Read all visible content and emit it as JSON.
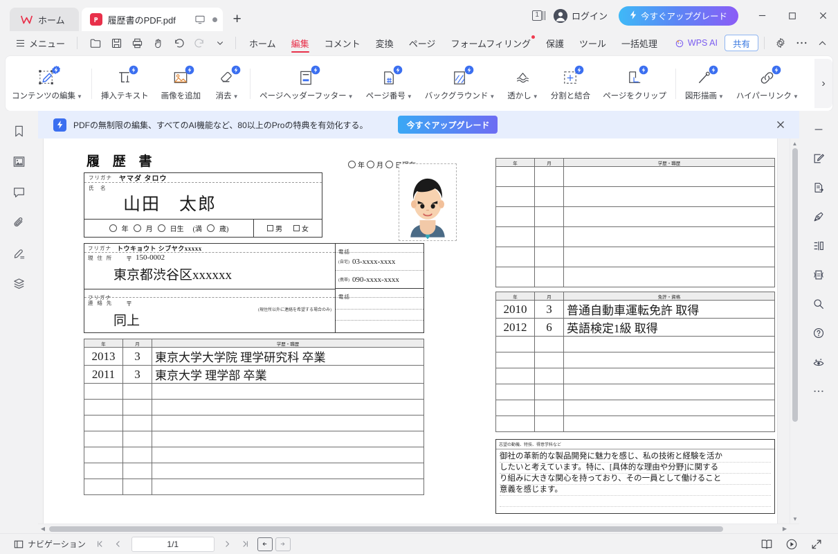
{
  "titlebar": {
    "home_tab": "ホーム",
    "doc_tab": "履歴書のPDF.pdf",
    "new_tab": "+",
    "page_count_badge": "1",
    "login_label": "ログイン",
    "upgrade_label": "今すぐアップグレード",
    "minimize": "–",
    "maximize": "□",
    "close": "✕"
  },
  "menubar": {
    "menu_label": "メニュー",
    "quick_actions": [
      "open-icon",
      "save-icon",
      "print-icon",
      "hand-icon",
      "undo-icon",
      "redo-icon",
      "chevron-down-icon"
    ],
    "tabs": [
      {
        "label": "ホーム",
        "active": false,
        "badge": false
      },
      {
        "label": "編集",
        "active": true,
        "badge": false
      },
      {
        "label": "コメント",
        "active": false,
        "badge": false
      },
      {
        "label": "変換",
        "active": false,
        "badge": false
      },
      {
        "label": "ページ",
        "active": false,
        "badge": false
      },
      {
        "label": "フォームフィリング",
        "active": false,
        "badge": true
      },
      {
        "label": "保護",
        "active": false,
        "badge": false
      },
      {
        "label": "ツール",
        "active": false,
        "badge": false
      },
      {
        "label": "一括処理",
        "active": false,
        "badge": false
      }
    ],
    "wps_ai": "WPS AI",
    "share": "共有"
  },
  "ribbon": {
    "items": [
      {
        "label": "コンテンツの編集",
        "icon": "content-edit-icon",
        "caret": true,
        "ai": true
      },
      {
        "label": "挿入テキスト",
        "icon": "insert-text-icon",
        "caret": false,
        "ai": true
      },
      {
        "label": "画像を追加",
        "icon": "add-image-icon",
        "caret": false,
        "ai": true
      },
      {
        "label": "消去",
        "icon": "erase-icon",
        "caret": true,
        "ai": true
      },
      {
        "label": "ページヘッダーフッター",
        "icon": "header-footer-icon",
        "caret": true,
        "ai": true
      },
      {
        "label": "ページ番号",
        "icon": "page-number-icon",
        "caret": true,
        "ai": true
      },
      {
        "label": "バックグラウンド",
        "icon": "background-icon",
        "caret": true,
        "ai": true
      },
      {
        "label": "透かし",
        "icon": "watermark-icon",
        "caret": true,
        "ai": false
      },
      {
        "label": "分割と結合",
        "icon": "split-merge-icon",
        "caret": false,
        "ai": true
      },
      {
        "label": "ページをクリップ",
        "icon": "crop-page-icon",
        "caret": false,
        "ai": true
      },
      {
        "label": "図形描画",
        "icon": "draw-shape-icon",
        "caret": true,
        "ai": true
      },
      {
        "label": "ハイパーリンク",
        "icon": "hyperlink-icon",
        "caret": true,
        "ai": true
      }
    ],
    "expand": "›"
  },
  "promo": {
    "text": "PDFの無制限の編集、すべてのAI機能など、80以上のProの特典を有効化する。",
    "cta": "今すぐアップグレード",
    "close": "✕"
  },
  "left_sidebar": [
    {
      "icon": "bookmark-icon",
      "name": "sidebar-bookmarks"
    },
    {
      "icon": "thumbnail-icon",
      "name": "sidebar-thumbnails"
    },
    {
      "icon": "comment-icon",
      "name": "sidebar-comments"
    },
    {
      "icon": "attachment-icon",
      "name": "sidebar-attachments"
    },
    {
      "icon": "signature-icon",
      "name": "sidebar-signatures"
    },
    {
      "icon": "layers-icon",
      "name": "sidebar-layers"
    }
  ],
  "right_sidebar": [
    {
      "icon": "collapse-icon",
      "name": "panel-collapse"
    },
    {
      "icon": "edit-square-icon",
      "name": "panel-edit"
    },
    {
      "icon": "export-doc-icon",
      "name": "panel-export"
    },
    {
      "icon": "pen-nib-icon",
      "name": "panel-sign"
    },
    {
      "icon": "compare-icon",
      "name": "panel-compare"
    },
    {
      "icon": "compress-icon",
      "name": "panel-compress"
    },
    {
      "icon": "search-icon",
      "name": "panel-search"
    },
    {
      "icon": "help-icon",
      "name": "panel-help"
    },
    {
      "icon": "ai-eye-icon",
      "name": "panel-ai-assistant"
    },
    {
      "icon": "more-icon",
      "name": "panel-more"
    }
  ],
  "statusbar": {
    "navigation": "ナビゲーション",
    "first_page": "|‹",
    "prev_page": "‹",
    "page_value": "1/1",
    "next_page": "›",
    "last_page": "›|",
    "fit_prev": "←",
    "fit_next": "→",
    "book_view": "book-view-icon",
    "play_view": "play-icon",
    "fullscreen": "fullscreen-icon"
  },
  "document": {
    "title": "履 歴 書",
    "date_line": {
      "year_label": "年",
      "month_label": "月",
      "day_label": "日現在"
    },
    "furigana_label": "フリガナ",
    "name_label": "氏　名",
    "name_furigana": "ヤマダ タロウ",
    "name_value": "山田　太郎",
    "birth_row": {
      "year": "年",
      "month": "月",
      "day": "日生",
      "age_prefix": "(満",
      "age_suffix": "歳)",
      "male": "男",
      "female": "女"
    },
    "address": {
      "furigana_label": "フリガナ",
      "furigana_value": "トウキョウト シブヤクxxxxx",
      "label": "現 住 所",
      "postal_mark": "〒",
      "postal_code": "150-0002",
      "value": "東京都渋谷区xxxxxx",
      "phone_label": "電話",
      "home_label": "(自宅)",
      "home_value": "03-xxxx-xxxx",
      "mobile_label": "(携帯)",
      "mobile_value": "090-xxxx-xxxx"
    },
    "contact": {
      "furigana_label": "フリガナ",
      "label": "連 絡 先",
      "postal_mark": "〒",
      "note": "(現住所以外に連絡を希望する場合のみ)",
      "value": "同上",
      "phone_label": "電話"
    },
    "education_table": {
      "headers": {
        "year": "年",
        "month": "月",
        "content": "学歴・職歴"
      },
      "rows": [
        {
          "year": "2013",
          "month": "3",
          "content": "東京大学大学院  理学研究科  卒業"
        },
        {
          "year": "2011",
          "month": "3",
          "content": "東京大学  理学部  卒業"
        },
        {
          "year": "",
          "month": "",
          "content": ""
        },
        {
          "year": "",
          "month": "",
          "content": ""
        },
        {
          "year": "",
          "month": "",
          "content": ""
        },
        {
          "year": "",
          "month": "",
          "content": ""
        },
        {
          "year": "",
          "month": "",
          "content": ""
        },
        {
          "year": "",
          "month": "",
          "content": ""
        },
        {
          "year": "",
          "month": "",
          "content": ""
        }
      ]
    },
    "right_history_table": {
      "headers": {
        "year": "年",
        "month": "月",
        "content": "学歴・職歴"
      },
      "rows": [
        {
          "year": "",
          "month": "",
          "content": ""
        },
        {
          "year": "",
          "month": "",
          "content": ""
        },
        {
          "year": "",
          "month": "",
          "content": ""
        },
        {
          "year": "",
          "month": "",
          "content": ""
        },
        {
          "year": "",
          "month": "",
          "content": ""
        },
        {
          "year": "",
          "month": "",
          "content": ""
        }
      ]
    },
    "license_table": {
      "headers": {
        "year": "年",
        "month": "月",
        "content": "免許・資格"
      },
      "rows": [
        {
          "year": "2010",
          "month": "3",
          "content": "普通自動車運転免許  取得"
        },
        {
          "year": "2012",
          "month": "6",
          "content": "英語検定1級  取得"
        },
        {
          "year": "",
          "month": "",
          "content": ""
        },
        {
          "year": "",
          "month": "",
          "content": ""
        },
        {
          "year": "",
          "month": "",
          "content": ""
        },
        {
          "year": "",
          "month": "",
          "content": ""
        },
        {
          "year": "",
          "month": "",
          "content": ""
        },
        {
          "year": "",
          "month": "",
          "content": ""
        }
      ]
    },
    "motivation": {
      "header": "志望の動機、特技、得意学科など",
      "lines": [
        "御社の革新的な製品開発に魅力を感じ、私の技術と経験を活か",
        "したいと考えています。特に、[具体的な理由や分野]に関する",
        "り組みに大きな関心を持っており、その一員として働けること",
        "意義を感じます。",
        "",
        ""
      ]
    }
  }
}
